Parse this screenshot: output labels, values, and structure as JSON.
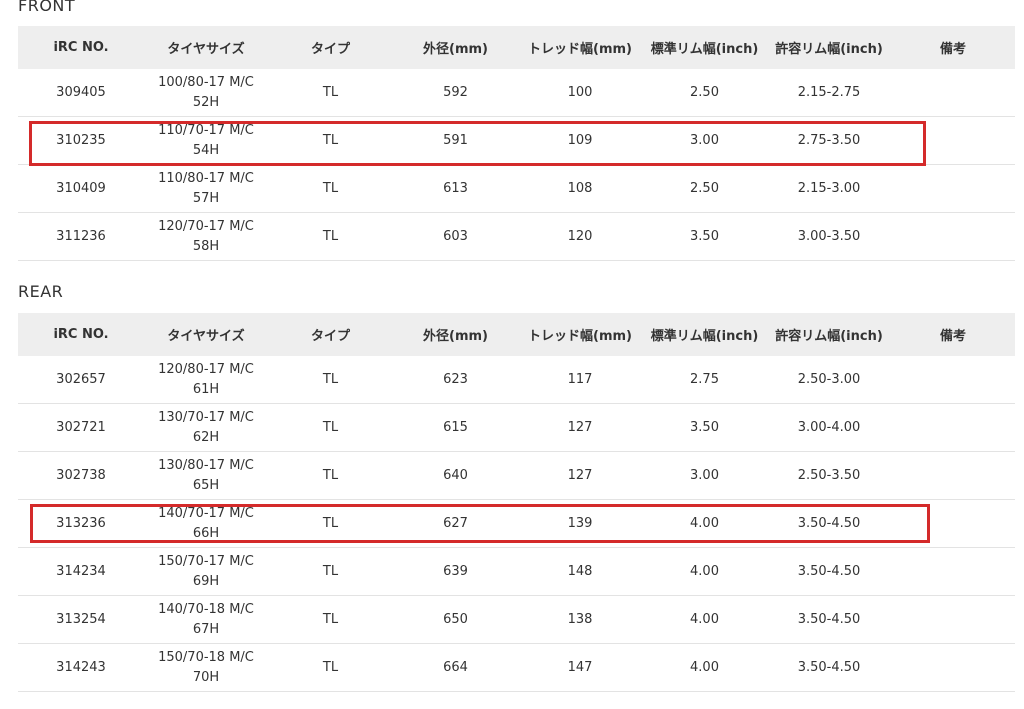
{
  "headers": {
    "irc_no": "iRC NO.",
    "tire_size": "タイヤサイズ",
    "type": "タイプ",
    "outer_diameter": "外径(mm)",
    "tread_width": "トレッド幅(mm)",
    "std_rim_width": "標準リム幅(inch)",
    "allowed_rim_width": "許容リム幅(inch)",
    "remarks": "備考"
  },
  "front": {
    "title": "FRONT",
    "rows": [
      {
        "irc": "309405",
        "size1": "100/80-17 M/C",
        "size2": "52H",
        "type": "TL",
        "od": "592",
        "tread": "100",
        "std": "2.50",
        "allowed": "2.15-2.75",
        "remarks": ""
      },
      {
        "irc": "310235",
        "size1": "110/70-17 M/C",
        "size2": "54H",
        "type": "TL",
        "od": "591",
        "tread": "109",
        "std": "3.00",
        "allowed": "2.75-3.50",
        "remarks": ""
      },
      {
        "irc": "310409",
        "size1": "110/80-17 M/C",
        "size2": "57H",
        "type": "TL",
        "od": "613",
        "tread": "108",
        "std": "2.50",
        "allowed": "2.15-3.00",
        "remarks": ""
      },
      {
        "irc": "311236",
        "size1": "120/70-17 M/C",
        "size2": "58H",
        "type": "TL",
        "od": "603",
        "tread": "120",
        "std": "3.50",
        "allowed": "3.00-3.50",
        "remarks": ""
      }
    ]
  },
  "rear": {
    "title": "REAR",
    "rows": [
      {
        "irc": "302657",
        "size1": "120/80-17 M/C",
        "size2": "61H",
        "type": "TL",
        "od": "623",
        "tread": "117",
        "std": "2.75",
        "allowed": "2.50-3.00",
        "remarks": ""
      },
      {
        "irc": "302721",
        "size1": "130/70-17 M/C",
        "size2": "62H",
        "type": "TL",
        "od": "615",
        "tread": "127",
        "std": "3.50",
        "allowed": "3.00-4.00",
        "remarks": ""
      },
      {
        "irc": "302738",
        "size1": "130/80-17 M/C",
        "size2": "65H",
        "type": "TL",
        "od": "640",
        "tread": "127",
        "std": "3.00",
        "allowed": "2.50-3.50",
        "remarks": ""
      },
      {
        "irc": "313236",
        "size1": "140/70-17 M/C",
        "size2": "66H",
        "type": "TL",
        "od": "627",
        "tread": "139",
        "std": "4.00",
        "allowed": "3.50-4.50",
        "remarks": ""
      },
      {
        "irc": "314234",
        "size1": "150/70-17 M/C",
        "size2": "69H",
        "type": "TL",
        "od": "639",
        "tread": "148",
        "std": "4.00",
        "allowed": "3.50-4.50",
        "remarks": ""
      },
      {
        "irc": "313254",
        "size1": "140/70-18 M/C",
        "size2": "67H",
        "type": "TL",
        "od": "650",
        "tread": "138",
        "std": "4.00",
        "allowed": "3.50-4.50",
        "remarks": ""
      },
      {
        "irc": "314243",
        "size1": "150/70-18 M/C",
        "size2": "70H",
        "type": "TL",
        "od": "664",
        "tread": "147",
        "std": "4.00",
        "allowed": "3.50-4.50",
        "remarks": ""
      }
    ]
  },
  "highlight_color": "#d42a2a",
  "header_bg": "#eeeeee"
}
